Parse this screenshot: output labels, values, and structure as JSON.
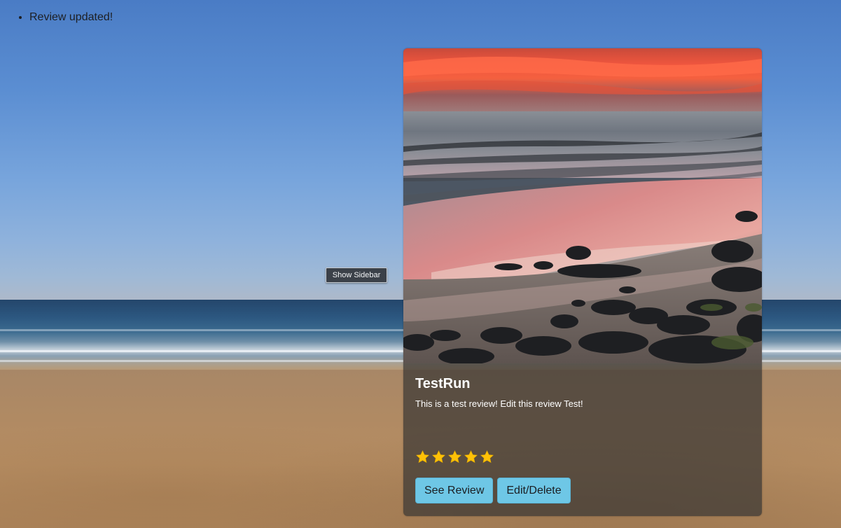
{
  "flash": {
    "messages": [
      "Review updated!"
    ]
  },
  "sidebar_toggle": {
    "label": "Show Sidebar"
  },
  "review_card": {
    "title": "TestRun",
    "text": "This is a test review! Edit this review Test!",
    "rating": 5,
    "rating_max": 5,
    "star_color": "#ffc107",
    "buttons": {
      "see_review": "See Review",
      "edit_delete": "Edit/Delete"
    },
    "button_color": "#6ec7e6"
  },
  "icons": {
    "star": "star-icon"
  }
}
